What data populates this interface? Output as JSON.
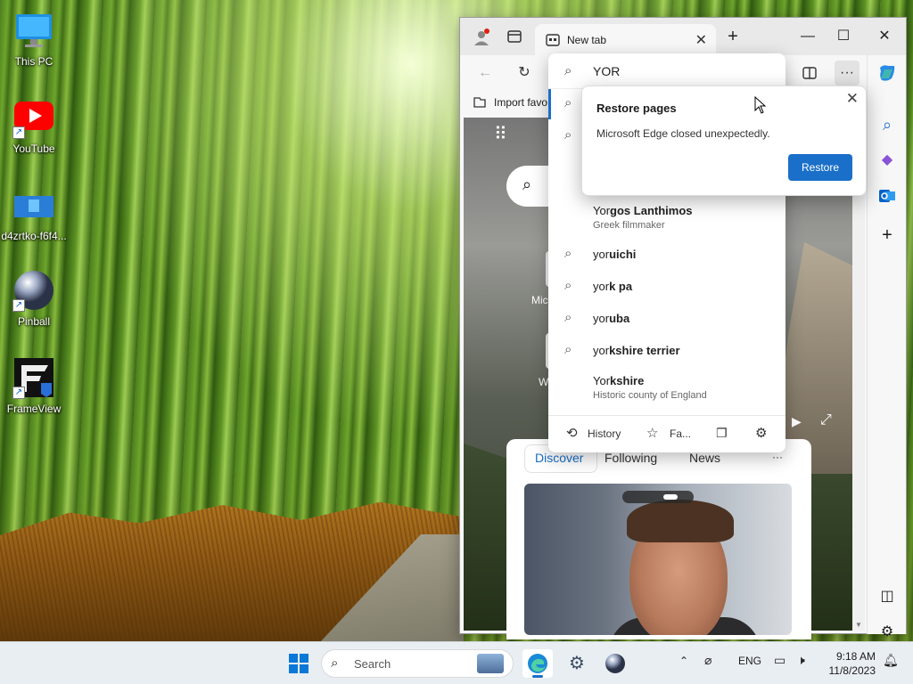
{
  "desktop": {
    "icons": [
      {
        "label": "This PC"
      },
      {
        "label": "YouTube"
      },
      {
        "label": "d4zrtko-f6f4..."
      },
      {
        "label": "Pinball"
      },
      {
        "label": "FrameView"
      }
    ]
  },
  "edge": {
    "tab_title": "New tab",
    "address_value": "YOR",
    "favorites_bar_item": "Import favo",
    "suggestions": [
      {
        "typed": "Yor",
        "rest": "gos Lanthimos",
        "sub": "Greek filmmaker"
      },
      {
        "typed": "yor",
        "rest": "uichi"
      },
      {
        "typed": "yor",
        "rest": "k pa"
      },
      {
        "typed": "yor",
        "rest": "uba"
      },
      {
        "typed": "yor",
        "rest": "kshire terrier"
      },
      {
        "typed": "Yor",
        "rest": "kshire",
        "sub": "Historic county of England"
      }
    ],
    "dropdown_footer": {
      "history": "History",
      "favorites": "Fa..."
    },
    "restore_popup": {
      "title": "Restore pages",
      "message": "Microsoft Edge closed unexpectedly.",
      "button": "Restore"
    },
    "ntp": {
      "partial_label_1": "Mic",
      "partial_label_2": "W",
      "feed_tabs": [
        "Discover",
        "Following",
        "News"
      ],
      "feed_more": "···"
    },
    "accent_color": "#1a6fc9"
  },
  "taskbar": {
    "search_placeholder": "Search",
    "language": "ENG",
    "time": "9:18 AM",
    "date": "11/8/2023"
  }
}
